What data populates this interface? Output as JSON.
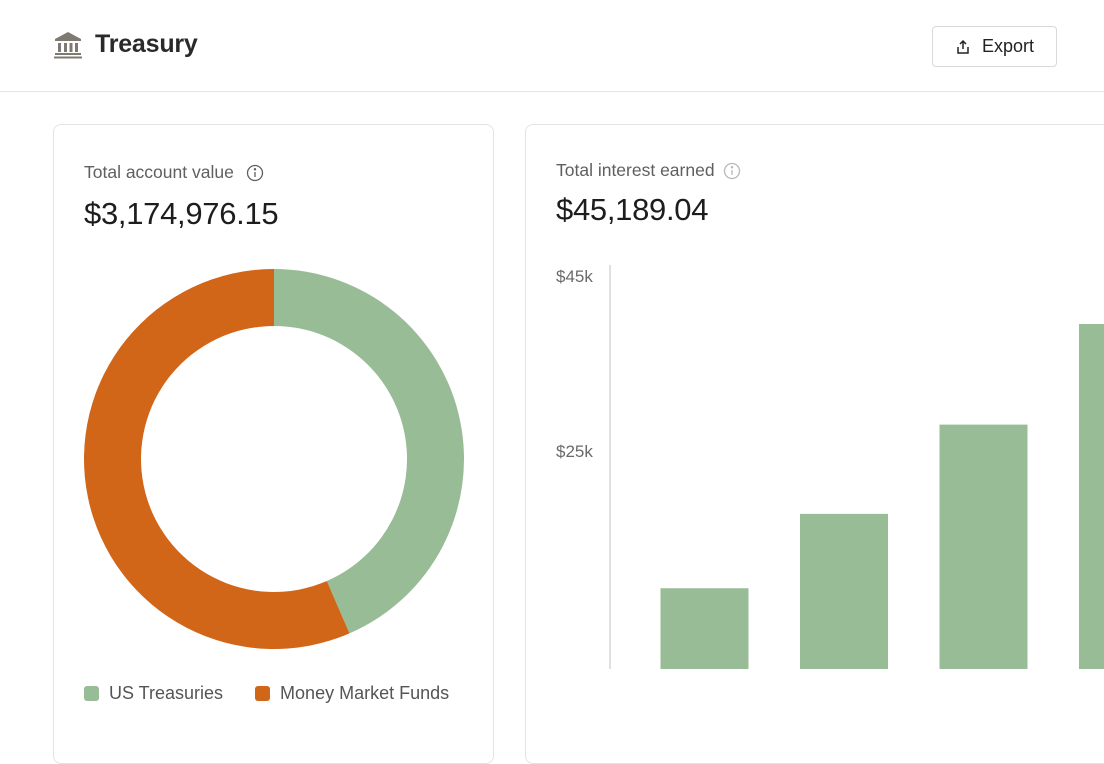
{
  "header": {
    "title": "Treasury",
    "export_label": "Export"
  },
  "account": {
    "label": "Total account value",
    "value": "$3,174,976.15",
    "legend": [
      {
        "name": "US Treasuries",
        "color": "#98bc96"
      },
      {
        "name": "Money Market Funds",
        "color": "#d16518"
      }
    ]
  },
  "interest": {
    "label": "Total interest earned",
    "value": "$45,189.04"
  },
  "chart_data": [
    {
      "type": "pie",
      "slices": [
        {
          "name": "US Treasuries",
          "value": 43.5,
          "color": "#98bc96"
        },
        {
          "name": "Money Market Funds",
          "value": 56.5,
          "color": "#d16518"
        }
      ]
    },
    {
      "type": "bar",
      "y_tick_labels": [
        "$45k",
        "$25k"
      ],
      "y_tick_values": [
        45000,
        25000
      ],
      "values": [
        9200,
        17700,
        27900,
        39400
      ],
      "color": "#98bc96"
    }
  ]
}
